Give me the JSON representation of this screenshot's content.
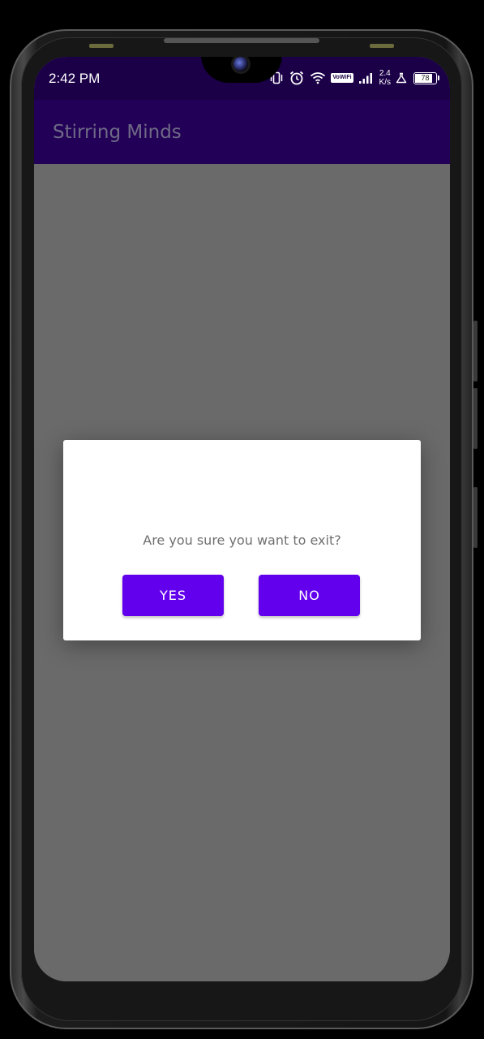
{
  "status_bar": {
    "time": "2:42 PM",
    "network_speed_value": "2.4",
    "network_speed_unit": "K/s",
    "vowifi_label": "VoWiFi",
    "battery_level": "78",
    "icons": [
      "vibrate-icon",
      "alarm-icon",
      "wifi-icon",
      "vowifi-icon",
      "signal-icon",
      "warning-icon",
      "battery-icon"
    ]
  },
  "app_bar": {
    "title": "Stirring Minds"
  },
  "dialog": {
    "message": "Are you sure you want to exit?",
    "yes_label": "YES",
    "no_label": "NO"
  },
  "colors": {
    "status_bar": "#1b0048",
    "app_bar": "#230057",
    "accent": "#6200ee",
    "scrim": "#6a6a6a",
    "dialog_bg": "#ffffff"
  }
}
